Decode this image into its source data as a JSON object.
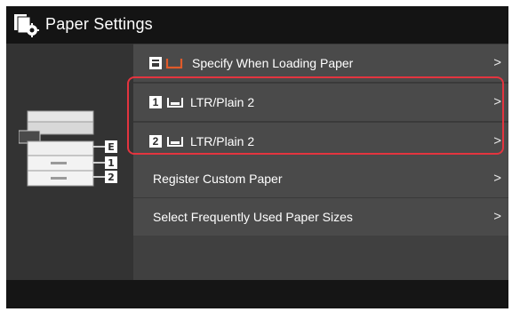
{
  "header": {
    "title": "Paper Settings",
    "icon": "paper-settings-icon"
  },
  "device": {
    "slots": [
      "E",
      "1",
      "2"
    ],
    "slot_icons": [
      "envelope-feeder-badge",
      "drawer-1-badge",
      "drawer-2-badge"
    ]
  },
  "menu": {
    "items": [
      {
        "label": "Specify When Loading Paper",
        "icon": "manual-feed-tray-icon",
        "chevron": ">"
      },
      {
        "badge": "1",
        "label": "LTR/Plain 2",
        "icon": "paper-drawer-icon",
        "chevron": ">"
      },
      {
        "badge": "2",
        "label": "LTR/Plain 2",
        "icon": "paper-drawer-icon",
        "chevron": ">"
      },
      {
        "label": "Register Custom Paper",
        "chevron": ">"
      },
      {
        "label": "Select Frequently Used Paper Sizes",
        "chevron": ">"
      }
    ]
  },
  "colors": {
    "highlight": "#e3343f",
    "accent": "#e05a2a"
  }
}
